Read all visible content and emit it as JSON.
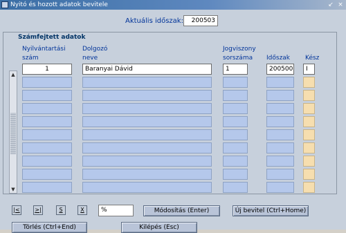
{
  "window": {
    "title": "Nyitó és hozott adatok bevitele"
  },
  "controls": {
    "restore_glyph": "↙",
    "close_glyph": "×"
  },
  "period": {
    "label": "Aktuális időszak:",
    "value": "200503"
  },
  "section": {
    "title": "Számfejtett adatok"
  },
  "columns": {
    "num": [
      "Nyilvántartási",
      "szám"
    ],
    "employee": [
      "Dolgozó",
      "neve"
    ],
    "jogviszony": [
      "Jogviszony",
      "sorszáma"
    ],
    "period": "Időszak",
    "kesz": "Kész"
  },
  "rows": [
    {
      "num": "1",
      "employee": "Baranyai Dávid",
      "jogviszony": "1",
      "period": "200500",
      "kesz": "I"
    },
    {
      "num": "",
      "employee": "",
      "jogviszony": "",
      "period": "",
      "kesz": ""
    },
    {
      "num": "",
      "employee": "",
      "jogviszony": "",
      "period": "",
      "kesz": ""
    },
    {
      "num": "",
      "employee": "",
      "jogviszony": "",
      "period": "",
      "kesz": ""
    },
    {
      "num": "",
      "employee": "",
      "jogviszony": "",
      "period": "",
      "kesz": ""
    },
    {
      "num": "",
      "employee": "",
      "jogviszony": "",
      "period": "",
      "kesz": ""
    },
    {
      "num": "",
      "employee": "",
      "jogviszony": "",
      "period": "",
      "kesz": ""
    },
    {
      "num": "",
      "employee": "",
      "jogviszony": "",
      "period": "",
      "kesz": ""
    },
    {
      "num": "",
      "employee": "",
      "jogviszony": "",
      "period": "",
      "kesz": ""
    },
    {
      "num": "",
      "employee": "",
      "jogviszony": "",
      "period": "",
      "kesz": ""
    }
  ],
  "nav": {
    "first": "|<",
    "last": ">|",
    "s": "S",
    "x": "X"
  },
  "search": {
    "value": "%"
  },
  "buttons": {
    "modify": "Módosítás (Enter)",
    "new_entry": "Új bevitel (Ctrl+Home)",
    "delete": "Törlés (Ctrl+End)",
    "exit": "Kilépés (Esc)"
  }
}
